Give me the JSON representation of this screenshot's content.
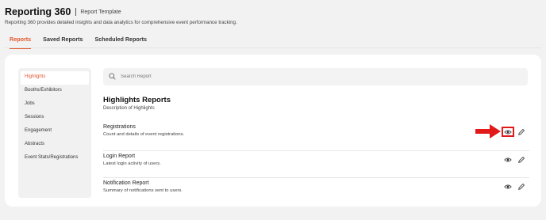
{
  "header": {
    "title": "Reporting 360",
    "template_tag": "Report Template",
    "description": "Reporting 360 provides detailed insights and data analytics for comprehensive event performance tracking."
  },
  "tabs": [
    "Reports",
    "Saved Reports",
    "Scheduled Reports"
  ],
  "sidebar": {
    "items": [
      "Highlights",
      "Booths/Exhibitors",
      "Jobs",
      "Sessions",
      "Engagement",
      "Abstracts",
      "Event Stats/Registrations"
    ]
  },
  "search": {
    "placeholder": "Search Report"
  },
  "section": {
    "title": "Highlights Reports",
    "description": "Description of Highlights"
  },
  "reports": [
    {
      "name": "Registrations",
      "description": "Count and details of event registrations."
    },
    {
      "name": "Login Report",
      "description": "Latest login activity of users."
    },
    {
      "name": "Notification Report",
      "description": "Summary of notifications sent to users."
    }
  ],
  "colors": {
    "accent": "#e0592d",
    "annotation": "#e11919"
  },
  "icons": {
    "view": "eye-icon",
    "edit": "pencil-icon",
    "search": "search-icon"
  }
}
